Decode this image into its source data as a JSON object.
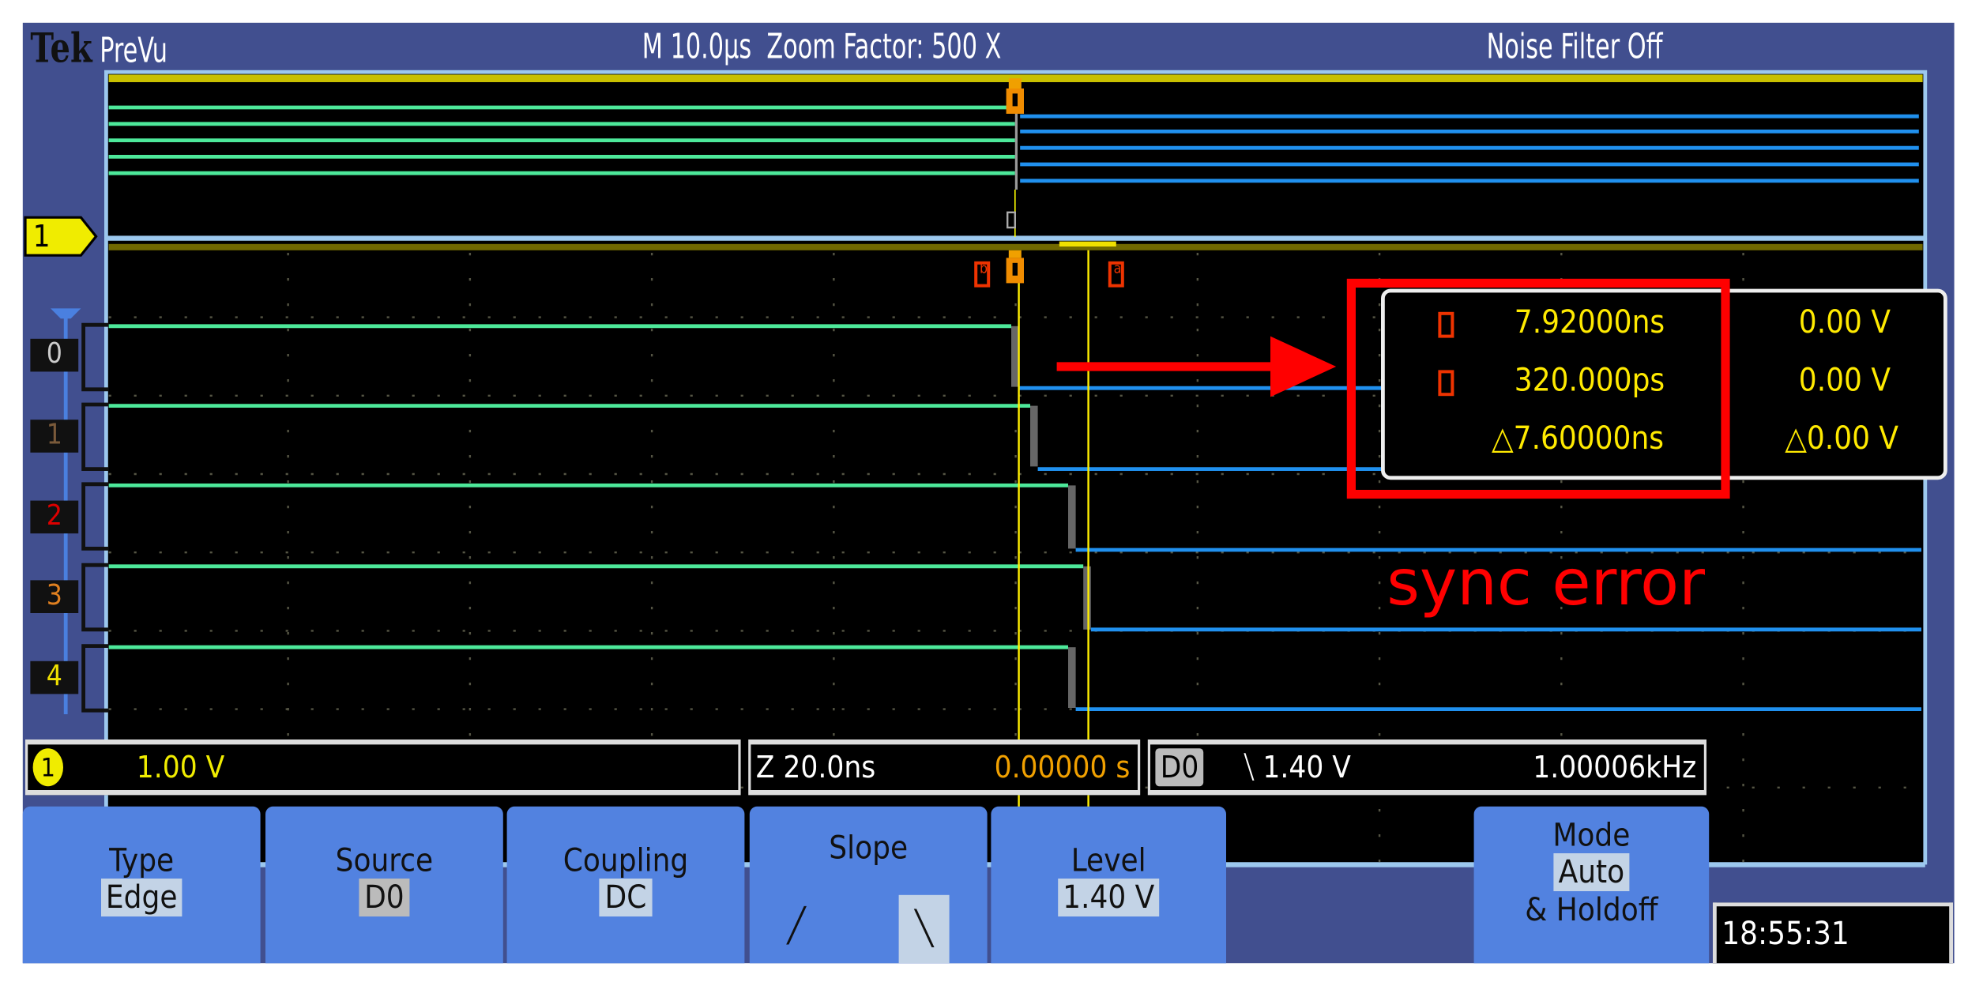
{
  "header": {
    "brand": "Tek",
    "mode": "PreVu",
    "timebase": "M 10.0µs",
    "zoom_factor": "Zoom Factor: 500 X",
    "noise_filter": "Noise Filter Off"
  },
  "channel_marker": "1",
  "digital_channels": [
    {
      "label": "0",
      "color": "#cccccc"
    },
    {
      "label": "1",
      "color": "#7a5a3a"
    },
    {
      "label": "2",
      "color": "#dd0000"
    },
    {
      "label": "3",
      "color": "#e08020"
    },
    {
      "label": "4",
      "color": "#f0e000"
    }
  ],
  "cursors": {
    "a_label": "a",
    "b_label": "b"
  },
  "readout": {
    "a_time": "7.92000ns",
    "a_volt": "0.00 V",
    "b_time": "320.000ps",
    "b_volt": "0.00 V",
    "delta_time": "△7.60000ns",
    "delta_volt": "△0.00 V"
  },
  "annotation": {
    "text": "sync error",
    "color": "#ff0000"
  },
  "status": {
    "ch1_badge": "1",
    "ch1_scale": "1.00 V",
    "zoom_scale": "Z 20.0ns",
    "position": "0.00000 s",
    "trig_source": "D0",
    "trig_level": "⧹ 1.40 V",
    "frequency": "1.00006kHz"
  },
  "menu": {
    "type": {
      "label": "Type",
      "value": "Edge"
    },
    "source": {
      "label": "Source",
      "value": "D0"
    },
    "coupling": {
      "label": "Coupling",
      "value": "DC"
    },
    "slope": {
      "label": "Slope",
      "rising": "╱",
      "falling": "╲"
    },
    "level": {
      "label": "Level",
      "value": "1.40 V"
    },
    "mode": {
      "label": "Mode",
      "value": "Auto",
      "extra": "& Holdoff"
    }
  },
  "clock": "18:55:31"
}
